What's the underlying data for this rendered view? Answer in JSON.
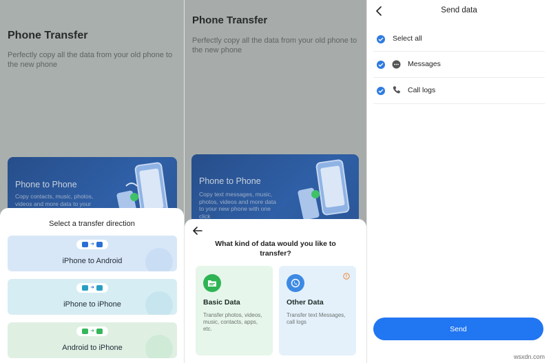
{
  "screen1": {
    "title": "Phone Transfer",
    "subtitle": "Perfectly copy all the data from your old phone to the new phone",
    "hero_title": "Phone to Phone",
    "hero_desc": "Copy contacts, music, photos, videos and more data to your new phone",
    "sheet_title": "Select a transfer direction",
    "directions": [
      {
        "label": "iPhone to Android",
        "bg": "#d8e7f7",
        "from_icon": "apple-icon",
        "to_icon": "android-icon"
      },
      {
        "label": "iPhone to iPhone",
        "bg": "#d6edf3",
        "from_icon": "apple-icon",
        "to_icon": "apple-icon"
      },
      {
        "label": "Android to iPhone",
        "bg": "#dff0e3",
        "from_icon": "android-icon",
        "to_icon": "apple-icon"
      }
    ]
  },
  "screen2": {
    "title": "Phone Transfer",
    "subtitle": "Perfectly copy all the data from your old phone to the new phone",
    "hero_title": "Phone to Phone",
    "hero_desc": "Copy text messages, music, photos, videos and more data to your new phone with one click",
    "question": "What kind of data would you like to transfer?",
    "cards": [
      {
        "title": "Basic Data",
        "desc": "Transfer photos, videos, music, contacts, apps, etc.",
        "bg": "#e6f6ea",
        "icon": "folder-icon",
        "icon_color": "#2fb455"
      },
      {
        "title": "Other Data",
        "desc": "Transfer text Messages, call logs",
        "bg": "#e4f1fb",
        "icon": "phone-chat-icon",
        "icon_color": "#3c8ae4"
      }
    ]
  },
  "screen3": {
    "title": "Send data",
    "rows": [
      {
        "label": "Select all",
        "icon": ""
      },
      {
        "label": "Messages",
        "icon": "message-icon"
      },
      {
        "label": "Call logs",
        "icon": "phone-icon"
      }
    ],
    "send_label": "Send"
  },
  "watermark": "wsxdn.com",
  "colors": {
    "accent": "#2176f1",
    "check": "#2f7be0",
    "hero": "#2b5798"
  }
}
